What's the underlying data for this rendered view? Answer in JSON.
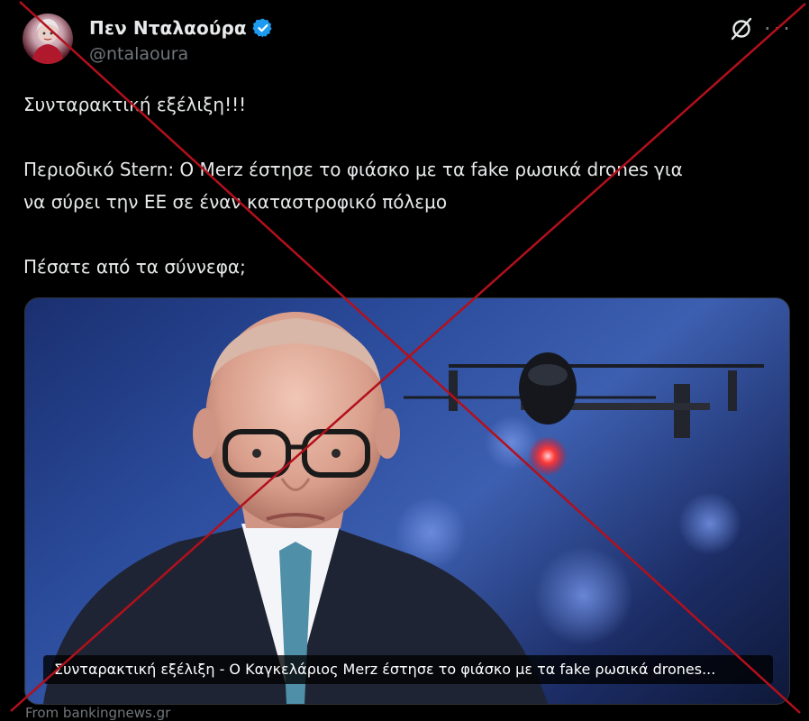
{
  "author": {
    "display_name": "Πεν Νταλαούρα",
    "handle": "@ntalaoura",
    "verified": true,
    "avatar_icon": "avatar-icon"
  },
  "actions": {
    "grok_icon": "grok-icon",
    "more_icon": "more-icon",
    "more_label": "···"
  },
  "tweet": {
    "lines": [
      "Συνταρακτική εξέλιξη!!!",
      "Περιοδικό Stern: Ο Merz έστησε το φιάσκο με τα fake ρωσικά drones για",
      "να σύρει την ΕΕ σε έναν καταστροφικό πόλεμο",
      "Πέσατε από τα σύννεφα;"
    ]
  },
  "card": {
    "caption": "Συνταρακτική εξέλιξη - Ο Καγκελάριος Merz έστησε το φιάσκο με τα fake ρωσικά drones...",
    "source": "From bankingnews.gr"
  },
  "colors": {
    "background": "#000000",
    "text": "#e7e9ea",
    "muted": "#71767b",
    "verified_blue": "#1d9bf0",
    "cross_red": "#b3101c"
  }
}
